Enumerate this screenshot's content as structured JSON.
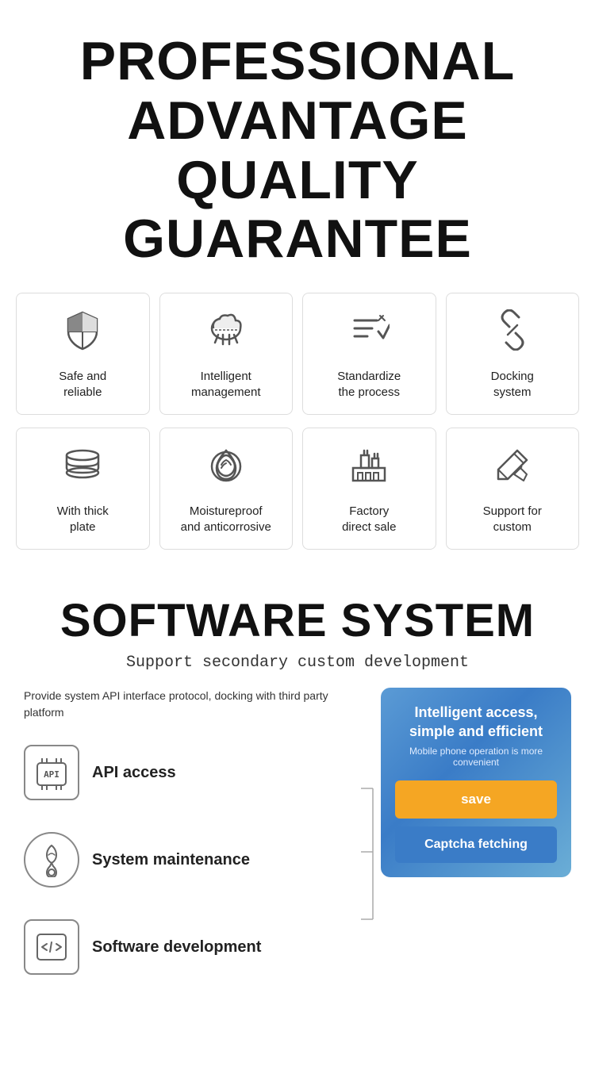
{
  "header": {
    "line1": "PROFESSIONAL",
    "line2": "ADVANTAGE",
    "line3": "QUALITY GUARANTEE"
  },
  "features": {
    "row1": [
      {
        "id": "safe-reliable",
        "label": "Safe and\nreliable",
        "icon": "shield"
      },
      {
        "id": "intelligent-management",
        "label": "Intelligent\nmanagement",
        "icon": "cloud"
      },
      {
        "id": "standardize-process",
        "label": "Standardize\nthe process",
        "icon": "list-check"
      },
      {
        "id": "docking-system",
        "label": "Docking\nsystem",
        "icon": "link"
      }
    ],
    "row2": [
      {
        "id": "thick-plate",
        "label": "With thick\nplate",
        "icon": "layers"
      },
      {
        "id": "moistureproof",
        "label": "Moistureproof\nand anticorrosive",
        "icon": "droplet"
      },
      {
        "id": "factory-direct",
        "label": "Factory\ndirect sale",
        "icon": "factory"
      },
      {
        "id": "support-custom",
        "label": "Support for\ncustom",
        "icon": "pen-tool"
      }
    ]
  },
  "software": {
    "title": "SOFTWARE SYSTEM",
    "subtitle": "Support secondary custom development",
    "description": "Provide system API interface protocol,\ndocking with third party platform",
    "items": [
      {
        "id": "api-access",
        "label": "API access",
        "icon": "api"
      },
      {
        "id": "system-maintenance",
        "label": "System\nmaintenance",
        "icon": "maintenance"
      },
      {
        "id": "software-development",
        "label": "Software\ndevelopment",
        "icon": "code"
      }
    ],
    "panel": {
      "title": "Intelligent access,\nsimple and efficient",
      "subtitle": "Mobile phone operation is more\nconvenient",
      "save_label": "save",
      "captcha_label": "Captcha fetching"
    }
  }
}
